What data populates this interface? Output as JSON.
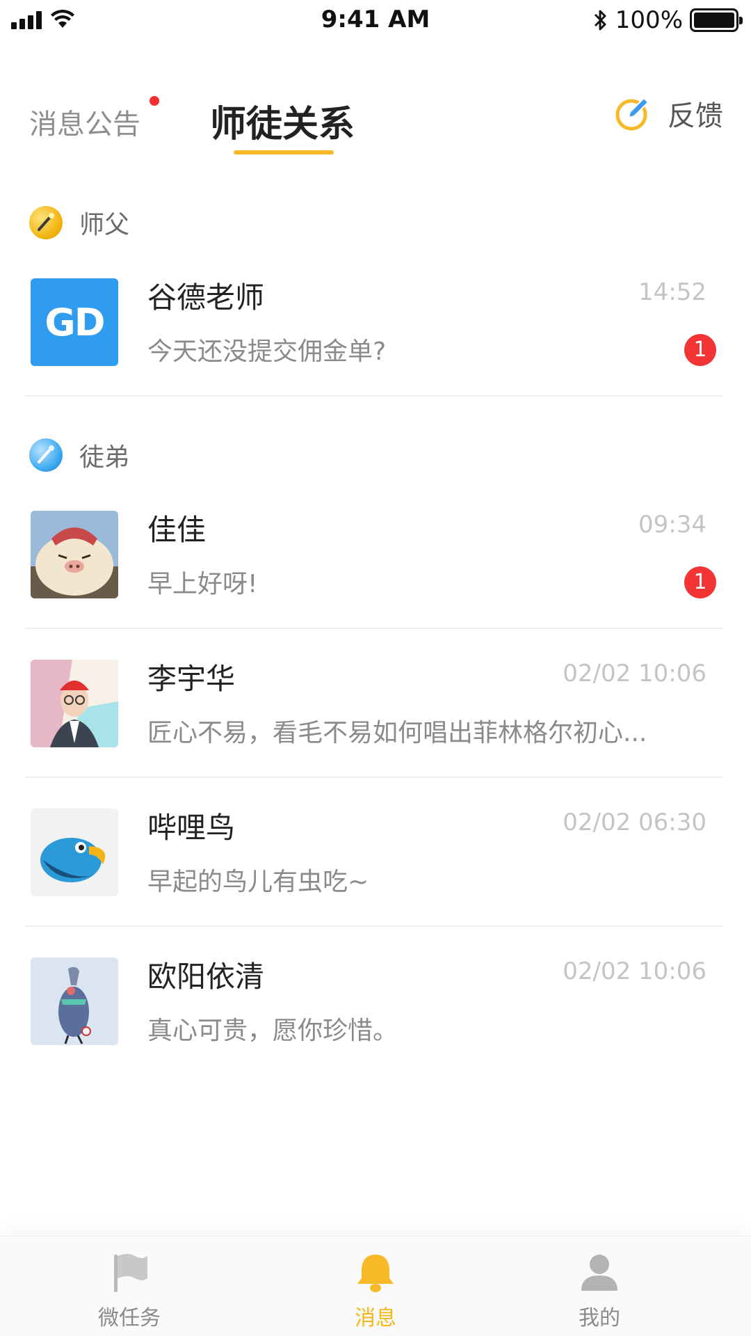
{
  "status_bar": {
    "time": "9:41 AM",
    "battery": "100%"
  },
  "tabs": {
    "notice": "消息公告",
    "relation": "师徒关系",
    "feedback": "反馈"
  },
  "master_section": {
    "label": "师父",
    "items": [
      {
        "name": "谷德老师",
        "time": "14:52",
        "preview": "今天还没提交佣金单?",
        "unread": "1",
        "avatar_text": "GD"
      }
    ]
  },
  "apprentice_section": {
    "label": "徒弟",
    "items": [
      {
        "name": "佳佳",
        "time": "09:34",
        "preview": "早上好呀!",
        "unread": "1"
      },
      {
        "name": "李宇华",
        "time": "02/02 10:06",
        "preview": "匠心不易，看毛不易如何唱出菲林格尔初心..."
      },
      {
        "name": "哔哩鸟",
        "time": "02/02 06:30",
        "preview": "早起的鸟儿有虫吃~"
      },
      {
        "name": "欧阳依清",
        "time": "02/02 10:06",
        "preview": "真心可贵，愿你珍惜。"
      }
    ]
  },
  "tab_bar": {
    "items": [
      {
        "label": "微任务",
        "icon": "flag-icon"
      },
      {
        "label": "消息",
        "icon": "bell-icon",
        "active": true
      },
      {
        "label": "我的",
        "icon": "person-icon"
      }
    ]
  },
  "colors": {
    "accent": "#f7b928",
    "unread": "#f23434",
    "gd_blue": "#2f9cf0"
  }
}
